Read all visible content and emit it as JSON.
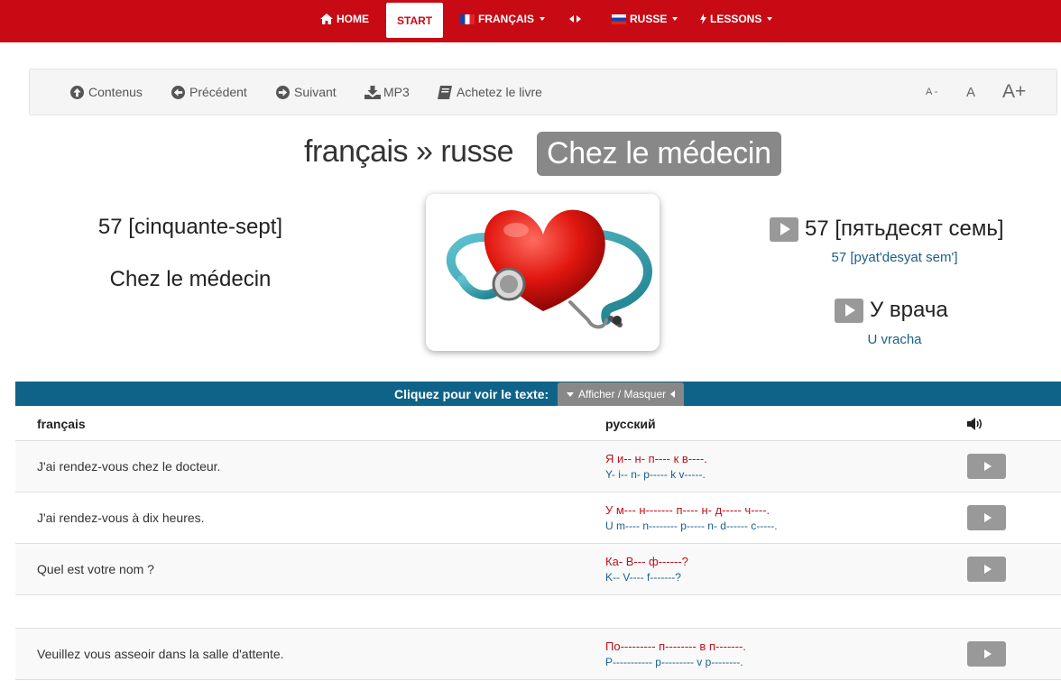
{
  "navbar": {
    "items": [
      {
        "label": "HOME",
        "icon": "home-icon"
      },
      {
        "label": "START"
      },
      {
        "label": "FRANÇAIS",
        "icon": "flag-fr-icon"
      },
      {
        "label": "",
        "icon": "swap-arrows-icon"
      },
      {
        "label": "RUSSE",
        "icon": "flag-ru-icon"
      },
      {
        "label": "LESSONS",
        "icon": "bolt-icon"
      }
    ],
    "color": "#c80a14"
  },
  "toolbar": {
    "items": [
      {
        "label": "Contenus",
        "icon": "arrow-up-circle-icon"
      },
      {
        "label": "Précédent",
        "icon": "arrow-left-circle-icon"
      },
      {
        "label": "Suivant",
        "icon": "arrow-right-circle-icon"
      },
      {
        "label": "MP3",
        "icon": "download-icon"
      },
      {
        "label": "Achetez le livre",
        "icon": "book-icon"
      }
    ],
    "font_controls": [
      "A -",
      "A",
      "A+"
    ]
  },
  "title": {
    "main": "français » russe",
    "badge": "Chez le médecin"
  },
  "lesson": {
    "left_number": "57 [cinquante-sept]",
    "left_title": "Chez le médecin",
    "right_number": "57 [пятьдесят семь]",
    "right_number_translit": "57 [pyat'desyat sem']",
    "right_title": "У врача",
    "right_title_translit": "U vracha",
    "image_icon": "heart-stethoscope-image"
  },
  "reveal_bar": {
    "prompt": "Cliquez pour voir le texte:",
    "toggle_label": "Afficher / Masquer",
    "color": "#0f6388"
  },
  "table": {
    "headers": {
      "source": "français",
      "target": "русский",
      "audio_icon": "speaker-icon"
    },
    "rows": [
      {
        "fr": "J'ai rendez-vous chez le docteur.",
        "ru": "Я и-- н- п---- к в----.",
        "translit": "Y- i-- n- p----- k v-----."
      },
      {
        "fr": "J'ai rendez-vous à dix heures.",
        "ru": "У м--- н------- п---- н- д----- ч----.",
        "translit": "U m---- n-------- p----- n- d------ c-----."
      },
      {
        "fr": "Quel est votre nom ?",
        "ru": "Ка- В--- ф------?",
        "translit": "K-- V---- f-------?"
      },
      {
        "fr": "",
        "ru": "",
        "translit": ""
      },
      {
        "fr": "Veuillez vous asseoir dans la salle d'attente.",
        "ru": "По--------- п-------- в п-------.",
        "translit": "P----------- p--------- v p--------."
      }
    ]
  }
}
